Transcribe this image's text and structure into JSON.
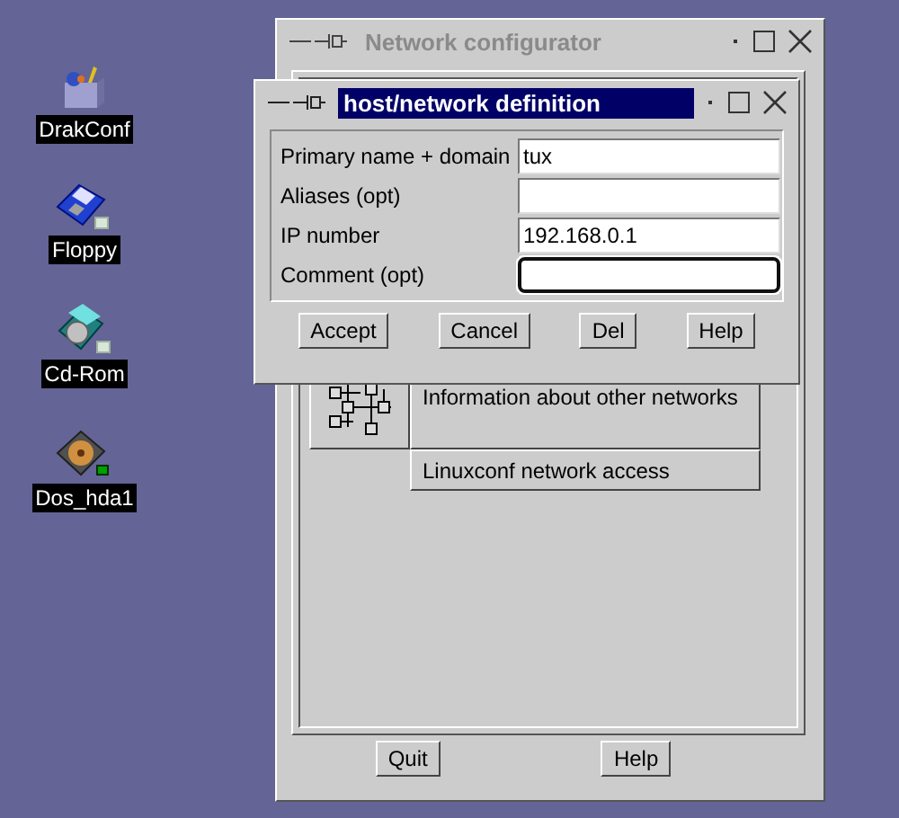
{
  "desktop_icons": [
    {
      "label": "DrakConf",
      "kind": "tools"
    },
    {
      "label": "Floppy",
      "kind": "floppy"
    },
    {
      "label": "Cd-Rom",
      "kind": "cdrom"
    },
    {
      "label": "Dos_hda1",
      "kind": "harddisk"
    }
  ],
  "main_window": {
    "title": "Network configurator",
    "active": false,
    "items": [
      {
        "label": "Information about other networks",
        "kind": "with_icon"
      },
      {
        "label": "Linuxconf network access",
        "kind": "plain"
      }
    ],
    "buttons": [
      "Quit",
      "Help"
    ]
  },
  "dialog": {
    "title": "host/network definition",
    "active": true,
    "fields": [
      {
        "label": "Primary name + domain",
        "value": "tux",
        "focused": false
      },
      {
        "label": "Aliases (opt)",
        "focused": false
      },
      {
        "label": "IP number",
        "value": "192.168.0.1",
        "focused": false
      },
      {
        "label": "Comment (opt)",
        "focused": true
      }
    ],
    "buttons": [
      "Accept",
      "Cancel",
      "Del",
      "Help"
    ]
  }
}
